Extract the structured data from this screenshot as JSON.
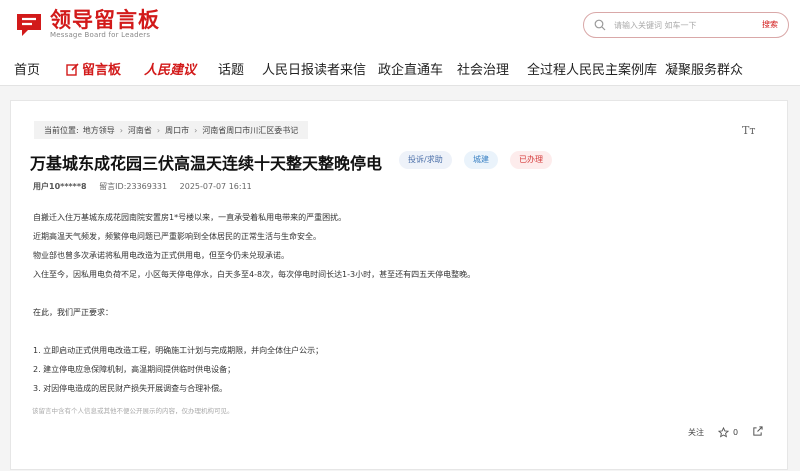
{
  "header": {
    "logo_title": "领导留言板",
    "logo_subtitle": "Message Board for Leaders",
    "search_placeholder": "请输入关键词 如车一下",
    "search_button": "搜索"
  },
  "nav": {
    "items": [
      {
        "label": "首页"
      },
      {
        "label": "留言板"
      },
      {
        "label": "人民建议"
      },
      {
        "label": "话题"
      },
      {
        "label": "人民日报读者来信"
      },
      {
        "label": "政企直通车"
      },
      {
        "label": "社会治理"
      },
      {
        "label": "全过程人民民主案例库"
      },
      {
        "label": "凝聚服务群众"
      }
    ]
  },
  "breadcrumb": {
    "prefix": "当前位置:",
    "items": [
      "地方领导",
      "河南省",
      "周口市",
      "河南省周口市川汇区委书记"
    ]
  },
  "message": {
    "title": "万基城东成花园三伏高温天连续十天整天整晚停电",
    "tags": {
      "type": "投诉/求助",
      "category": "城建",
      "status": "已办理"
    },
    "user": "用户10*****8",
    "id_label": "留言ID:23369331",
    "date": "2025-07-07 16:11",
    "paragraphs": [
      "自搬迁入住万基城东成花园南院安置房1*号楼以来，一直承受着私用电带来的严重困扰。",
      "近期高温天气频发，频繁停电问题已严重影响到全体居民的正常生活与生命安全。",
      "物业部也曾多次承诺将私用电改造为正式供用电，但至今仍未兑现承诺。",
      "入住至今，因私用电负荷不足，小区每天停电停水，白天多至4-8次，每次停电时间长达1-3小时，甚至还有四五天停电整晚。",
      "在此，我们严正要求：",
      "1. 立即启动正式供用电改造工程，明确施工计划与完成期限，并向全体住户公示；",
      "2. 建立停电应急保障机制，高温期间提供临时供电设备；",
      "3. 对因停电造成的居民财产损失开展调查与合理补偿。"
    ],
    "disclaimer": "该留言中含有个人信息或其他不便公开展示的内容，仅办理机构可见。"
  },
  "actions": {
    "follow": "关注",
    "like_count": "0"
  },
  "colors": {
    "brand_red": "#d21a1a"
  }
}
